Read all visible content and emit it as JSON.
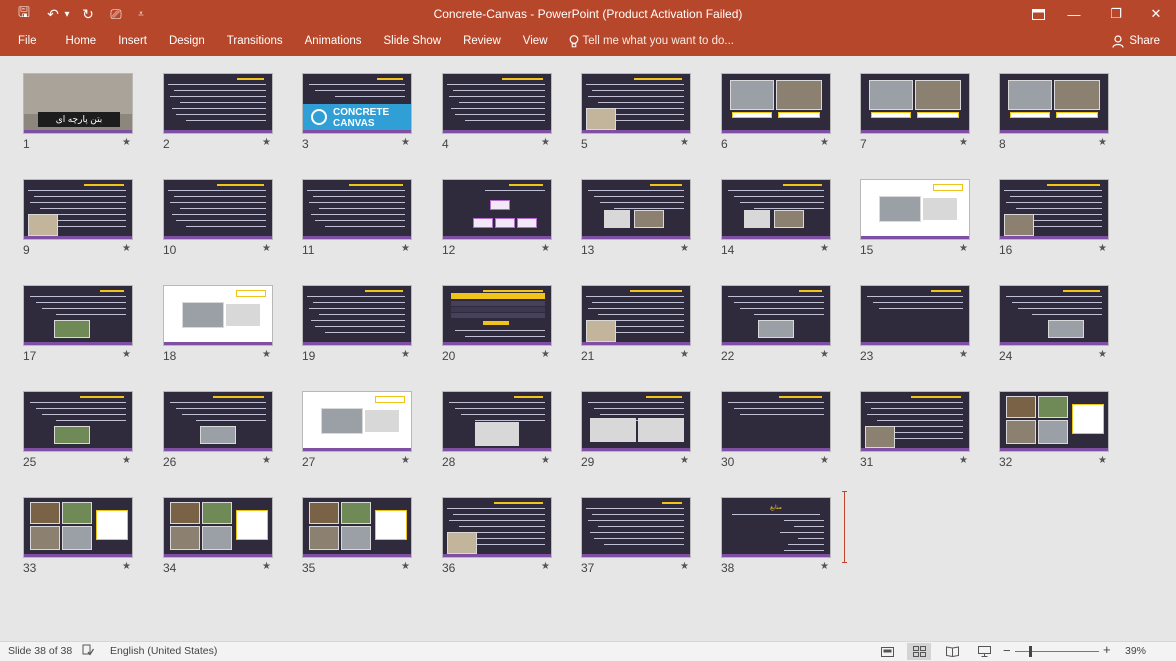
{
  "window": {
    "title": "Concrete-Canvas - PowerPoint (Product Activation Failed)",
    "ribbon_display_icon": "ribbon-display-options-icon",
    "minimize_glyph": "—",
    "restore_glyph": "❐",
    "close_glyph": "✕"
  },
  "quick_access": {
    "save_glyph": "🖫",
    "undo_glyph": "↶",
    "undo_dropdown_glyph": "▾",
    "redo_glyph": "↻",
    "present_glyph": "⎚",
    "customize_glyph": "⩡"
  },
  "ribbon": {
    "tabs": [
      "File",
      "Home",
      "Insert",
      "Design",
      "Transitions",
      "Animations",
      "Slide Show",
      "Review",
      "View"
    ],
    "tell_me": "Tell me what you want to do...",
    "share": "Share"
  },
  "colors": {
    "accent": "#b7472a",
    "slide_bg": "#2f2b3d",
    "slide_bar": "#7e4fa3",
    "highlight": "#f0c419"
  },
  "slides": [
    {
      "number": "1",
      "star": "★",
      "style": "cover",
      "cover_text": "بتن پارچه ای"
    },
    {
      "number": "2",
      "star": "★",
      "style": "text"
    },
    {
      "number": "3",
      "star": "★",
      "style": "logo",
      "logo_text": "CONCRETE CANVAS"
    },
    {
      "number": "4",
      "star": "★",
      "style": "text"
    },
    {
      "number": "5",
      "star": "★",
      "style": "text-photo"
    },
    {
      "number": "6",
      "star": "★",
      "style": "two-photos"
    },
    {
      "number": "7",
      "star": "★",
      "style": "two-photos"
    },
    {
      "number": "8",
      "star": "★",
      "style": "two-photos"
    },
    {
      "number": "9",
      "star": "★",
      "style": "text-photo"
    },
    {
      "number": "10",
      "star": "★",
      "style": "text"
    },
    {
      "number": "11",
      "star": "★",
      "style": "text"
    },
    {
      "number": "12",
      "star": "★",
      "style": "diagram"
    },
    {
      "number": "13",
      "star": "★",
      "style": "text-two-photos"
    },
    {
      "number": "14",
      "star": "★",
      "style": "text-two-photos"
    },
    {
      "number": "15",
      "star": "★",
      "style": "white-figure"
    },
    {
      "number": "16",
      "star": "★",
      "style": "text-photo"
    },
    {
      "number": "17",
      "star": "★",
      "style": "text-photo-bottom"
    },
    {
      "number": "18",
      "star": "★",
      "style": "white-figure"
    },
    {
      "number": "19",
      "star": "★",
      "style": "text"
    },
    {
      "number": "20",
      "star": "★",
      "style": "table"
    },
    {
      "number": "21",
      "star": "★",
      "style": "text-photo"
    },
    {
      "number": "22",
      "star": "★",
      "style": "text-photo-bottom"
    },
    {
      "number": "23",
      "star": "★",
      "style": "text-short"
    },
    {
      "number": "24",
      "star": "★",
      "style": "text-photo-bottom"
    },
    {
      "number": "25",
      "star": "★",
      "style": "text-photo-bottom"
    },
    {
      "number": "26",
      "star": "★",
      "style": "text-photo-bottom"
    },
    {
      "number": "27",
      "star": "★",
      "style": "white-figure"
    },
    {
      "number": "28",
      "star": "★",
      "style": "text-figure"
    },
    {
      "number": "29",
      "star": "★",
      "style": "text-figure-wide"
    },
    {
      "number": "30",
      "star": "★",
      "style": "text-short"
    },
    {
      "number": "31",
      "star": "★",
      "style": "text-photo"
    },
    {
      "number": "32",
      "star": "★",
      "style": "photo-grid"
    },
    {
      "number": "33",
      "star": "★",
      "style": "photo-grid"
    },
    {
      "number": "34",
      "star": "★",
      "style": "photo-grid"
    },
    {
      "number": "35",
      "star": "★",
      "style": "photo-grid"
    },
    {
      "number": "36",
      "star": "★",
      "style": "text-photo"
    },
    {
      "number": "37",
      "star": "★",
      "style": "text"
    },
    {
      "number": "38",
      "star": "★",
      "style": "references",
      "heading": "منابع"
    }
  ],
  "status": {
    "slide_info": "Slide 38 of 38",
    "spell_check_icon": "spell-check-icon",
    "language": "English (United States)",
    "zoom": "39%",
    "zoom_fraction": 0.39,
    "active_view": "slide-sorter"
  }
}
